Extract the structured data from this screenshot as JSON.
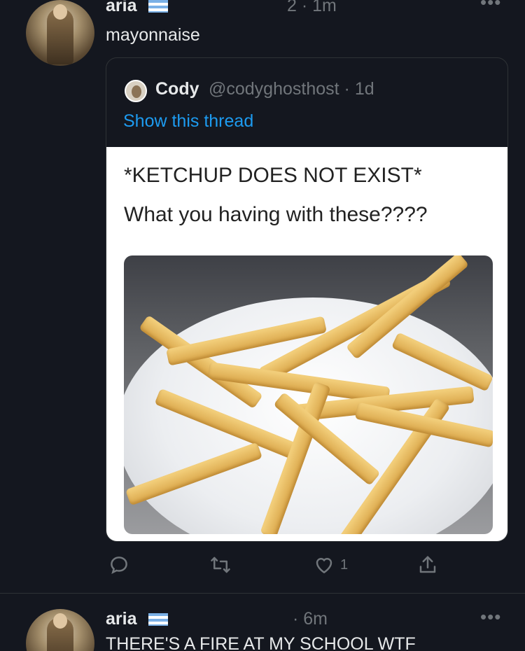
{
  "tweet_1": {
    "display_name": "aria",
    "time": "2 · 1m",
    "text": "mayonnaise",
    "quote": {
      "name": "Cody",
      "handle_time": "@codyghosthost · 1d",
      "thread_link": "Show this thread",
      "meme_line_1": "*KETCHUP DOES NOT EXIST*",
      "meme_line_2": "What you having with these????"
    },
    "actions": {
      "like_count": "1"
    }
  },
  "tweet_2": {
    "display_name": "aria",
    "time": "· 6m",
    "text": "THERE'S A FIRE AT MY SCHOOL WTF"
  },
  "icons": {
    "more": "more-icon",
    "reply": "reply-icon",
    "retweet": "retweet-icon",
    "like": "heart-icon",
    "share": "share-icon",
    "flag": "flag-icon"
  },
  "colors": {
    "background": "#14171f",
    "link": "#1d9bf0",
    "muted": "#71767b"
  }
}
